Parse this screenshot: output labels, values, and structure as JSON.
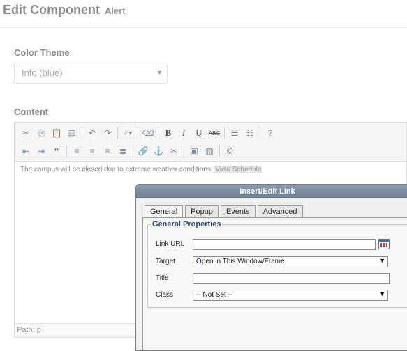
{
  "header": {
    "title": "Edit Component",
    "subtitle": "Alert"
  },
  "color_theme": {
    "label": "Color Theme",
    "value": "Info (blue)"
  },
  "content": {
    "label": "Content",
    "text": "The campus will be closed due to extreme weather conditions.",
    "link_text": "View Schedule",
    "status_path": "Path: p"
  },
  "toolbar": {
    "row1": [
      {
        "name": "cut-icon",
        "glyph": "✂"
      },
      {
        "name": "copy-icon",
        "glyph": "⎘"
      },
      {
        "name": "paste-icon",
        "glyph": "📋"
      },
      {
        "name": "paste-text-icon",
        "glyph": "▤"
      },
      {
        "sep": true
      },
      {
        "name": "undo-icon",
        "glyph": "↶"
      },
      {
        "name": "redo-icon",
        "glyph": "↷"
      },
      {
        "sep": true
      },
      {
        "name": "spellcheck-icon",
        "glyph": "✓▾",
        "cls": "small"
      },
      {
        "sep": true
      },
      {
        "name": "eraser-icon",
        "glyph": "⌫"
      },
      {
        "sep": true
      },
      {
        "name": "bold-icon",
        "glyph": "B",
        "cls": "bold"
      },
      {
        "name": "italic-icon",
        "glyph": "I",
        "cls": "italic"
      },
      {
        "name": "underline-icon",
        "glyph": "U",
        "cls": "under"
      },
      {
        "name": "strikethrough-icon",
        "glyph": "ABC",
        "cls": "strike"
      },
      {
        "sep": true
      },
      {
        "name": "bullet-list-icon",
        "glyph": "☰"
      },
      {
        "name": "numbered-list-icon",
        "glyph": "☷"
      },
      {
        "sep": true
      },
      {
        "name": "help-icon",
        "glyph": "?"
      }
    ],
    "row2": [
      {
        "name": "outdent-icon",
        "glyph": "⇤"
      },
      {
        "name": "indent-icon",
        "glyph": "⇥"
      },
      {
        "name": "blockquote-icon",
        "glyph": "“",
        "cls": "bold"
      },
      {
        "sep": true
      },
      {
        "name": "align-left-icon",
        "glyph": "≡"
      },
      {
        "name": "align-center-icon",
        "glyph": "≡"
      },
      {
        "name": "align-right-icon",
        "glyph": "≡"
      },
      {
        "name": "align-justify-icon",
        "glyph": "≣"
      },
      {
        "sep": true
      },
      {
        "name": "link-icon",
        "glyph": "🔗"
      },
      {
        "name": "anchor-icon",
        "glyph": "⚓"
      },
      {
        "name": "unlink-icon",
        "glyph": "✂"
      },
      {
        "sep": true
      },
      {
        "name": "image-icon",
        "glyph": "▣"
      },
      {
        "name": "media-icon",
        "glyph": "▥"
      },
      {
        "sep": true
      },
      {
        "name": "copyright-icon",
        "glyph": "©"
      }
    ]
  },
  "dialog": {
    "title": "Insert/Edit Link",
    "tabs": [
      "General",
      "Popup",
      "Events",
      "Advanced"
    ],
    "active_tab": "General",
    "legend": "General Properties",
    "fields": {
      "link_url": {
        "label": "Link URL",
        "value": ""
      },
      "target": {
        "label": "Target",
        "value": "Open in This Window/Frame"
      },
      "title": {
        "label": "Title",
        "value": ""
      },
      "class": {
        "label": "Class",
        "value": "-- Not Set --"
      }
    }
  }
}
